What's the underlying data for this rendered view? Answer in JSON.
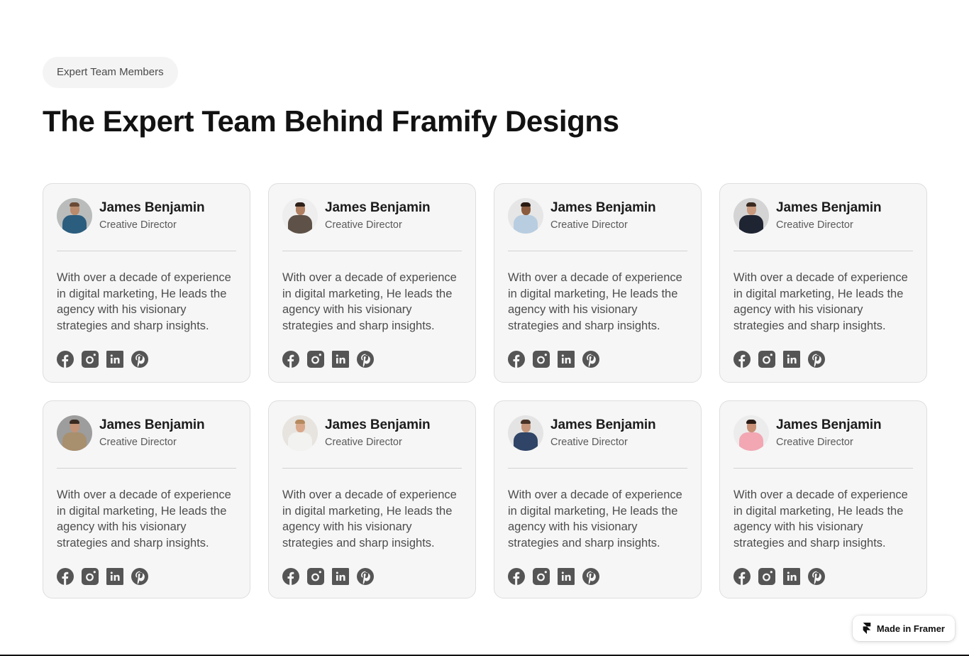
{
  "header": {
    "eyebrow": "Expert Team Members",
    "title": "The Expert Team Behind Framify Designs"
  },
  "team": [
    {
      "name": "James Benjamin",
      "role": "Creative Director",
      "bio": "With over a decade of experience in digital marketing, He leads the agency with his visionary strategies and sharp insights.",
      "avatar": {
        "bg": "#b9bcbb",
        "shirt": "#2b5d7e",
        "skin": "#b98a6c",
        "hair": "#6b4a35"
      }
    },
    {
      "name": "James Benjamin",
      "role": "Creative Director",
      "bio": "With over a decade of experience in digital marketing, He leads the agency with his visionary strategies and sharp insights.",
      "avatar": {
        "bg": "#eeeeee",
        "shirt": "#5e5147",
        "skin": "#b07f62",
        "hair": "#2e2019"
      }
    },
    {
      "name": "James Benjamin",
      "role": "Creative Director",
      "bio": "With over a decade of experience in digital marketing, He leads the agency with his visionary strategies and sharp insights.",
      "avatar": {
        "bg": "#e6e6e6",
        "shirt": "#b8cde0",
        "skin": "#8a5b3e",
        "hair": "#2a1a12"
      }
    },
    {
      "name": "James Benjamin",
      "role": "Creative Director",
      "bio": "With over a decade of experience in digital marketing, He leads the agency with his visionary strategies and sharp insights.",
      "avatar": {
        "bg": "#d4d4d4",
        "shirt": "#1f2433",
        "skin": "#c99a7e",
        "hair": "#3a2a20"
      }
    },
    {
      "name": "James Benjamin",
      "role": "Creative Director",
      "bio": "With over a decade of experience in digital marketing, He leads the agency with his visionary strategies and sharp insights.",
      "avatar": {
        "bg": "#9c9d9c",
        "shirt": "#a88f6e",
        "skin": "#c49274",
        "hair": "#3a2a20"
      }
    },
    {
      "name": "James Benjamin",
      "role": "Creative Director",
      "bio": "With over a decade of experience in digital marketing, He leads the agency with his visionary strategies and sharp insights.",
      "avatar": {
        "bg": "#e7e3de",
        "shirt": "#f2f2f0",
        "skin": "#d9a88a",
        "hair": "#b58a5e"
      }
    },
    {
      "name": "James Benjamin",
      "role": "Creative Director",
      "bio": "With over a decade of experience in digital marketing, He leads the agency with his visionary strategies and sharp insights.",
      "avatar": {
        "bg": "#e4e4e4",
        "shirt": "#2f4466",
        "skin": "#c4957a",
        "hair": "#4a3326"
      }
    },
    {
      "name": "James Benjamin",
      "role": "Creative Director",
      "bio": "With over a decade of experience in digital marketing, He leads the agency with his visionary strategies and sharp insights.",
      "avatar": {
        "bg": "#ececec",
        "shirt": "#f2a7b3",
        "skin": "#c99076",
        "hair": "#2a1c15"
      }
    }
  ],
  "socials": [
    {
      "icon": "facebook-icon",
      "label": "Facebook"
    },
    {
      "icon": "instagram-icon",
      "label": "Instagram"
    },
    {
      "icon": "linkedin-icon",
      "label": "LinkedIn"
    },
    {
      "icon": "pinterest-icon",
      "label": "Pinterest"
    }
  ],
  "colors": {
    "icon": "#555555",
    "card_bg": "#f6f6f6",
    "card_border": "#dedede"
  },
  "badge": {
    "label": "Made in Framer"
  }
}
